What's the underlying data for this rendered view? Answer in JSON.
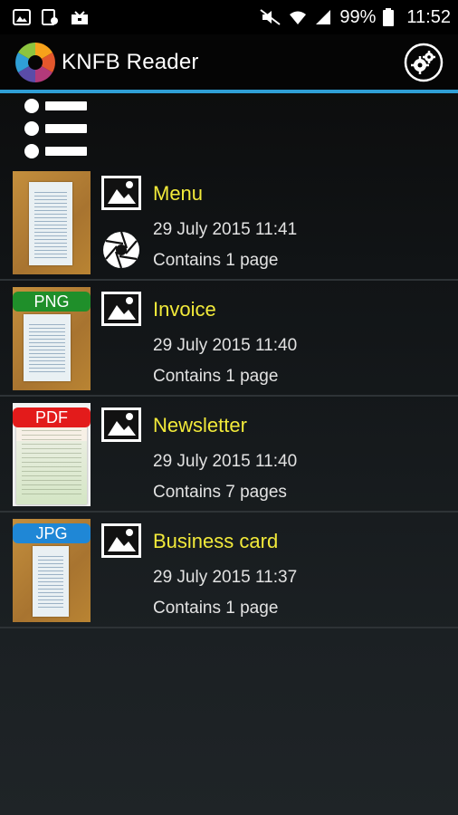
{
  "status_bar": {
    "battery": "99%",
    "time": "11:52"
  },
  "app": {
    "title": "KNFB Reader"
  },
  "documents": [
    {
      "title": "Menu",
      "date": "29 July 2015 11:41",
      "pages": "Contains 1 page",
      "badge": "",
      "badge_color": ""
    },
    {
      "title": "Invoice",
      "date": "29 July 2015 11:40",
      "pages": "Contains 1 page",
      "badge": "PNG",
      "badge_color": "#1f8f2a"
    },
    {
      "title": "Newsletter",
      "date": "29 July 2015 11:40",
      "pages": "Contains 7 pages",
      "badge": "PDF",
      "badge_color": "#e31b1b"
    },
    {
      "title": "Business card",
      "date": "29 July 2015 11:37",
      "pages": "Contains 1 page",
      "badge": "JPG",
      "badge_color": "#1f87d6"
    }
  ],
  "colors": {
    "accent": "#2f9fd6",
    "title_yellow": "#f2ea3a"
  },
  "icons": [
    "gallery-icon",
    "screenshot-icon",
    "inbox-icon",
    "mute-icon",
    "wifi-icon",
    "signal-icon",
    "battery-icon",
    "app-logo",
    "settings-gears-icon",
    "list-view-icon",
    "image-icon",
    "camera-aperture-icon"
  ]
}
